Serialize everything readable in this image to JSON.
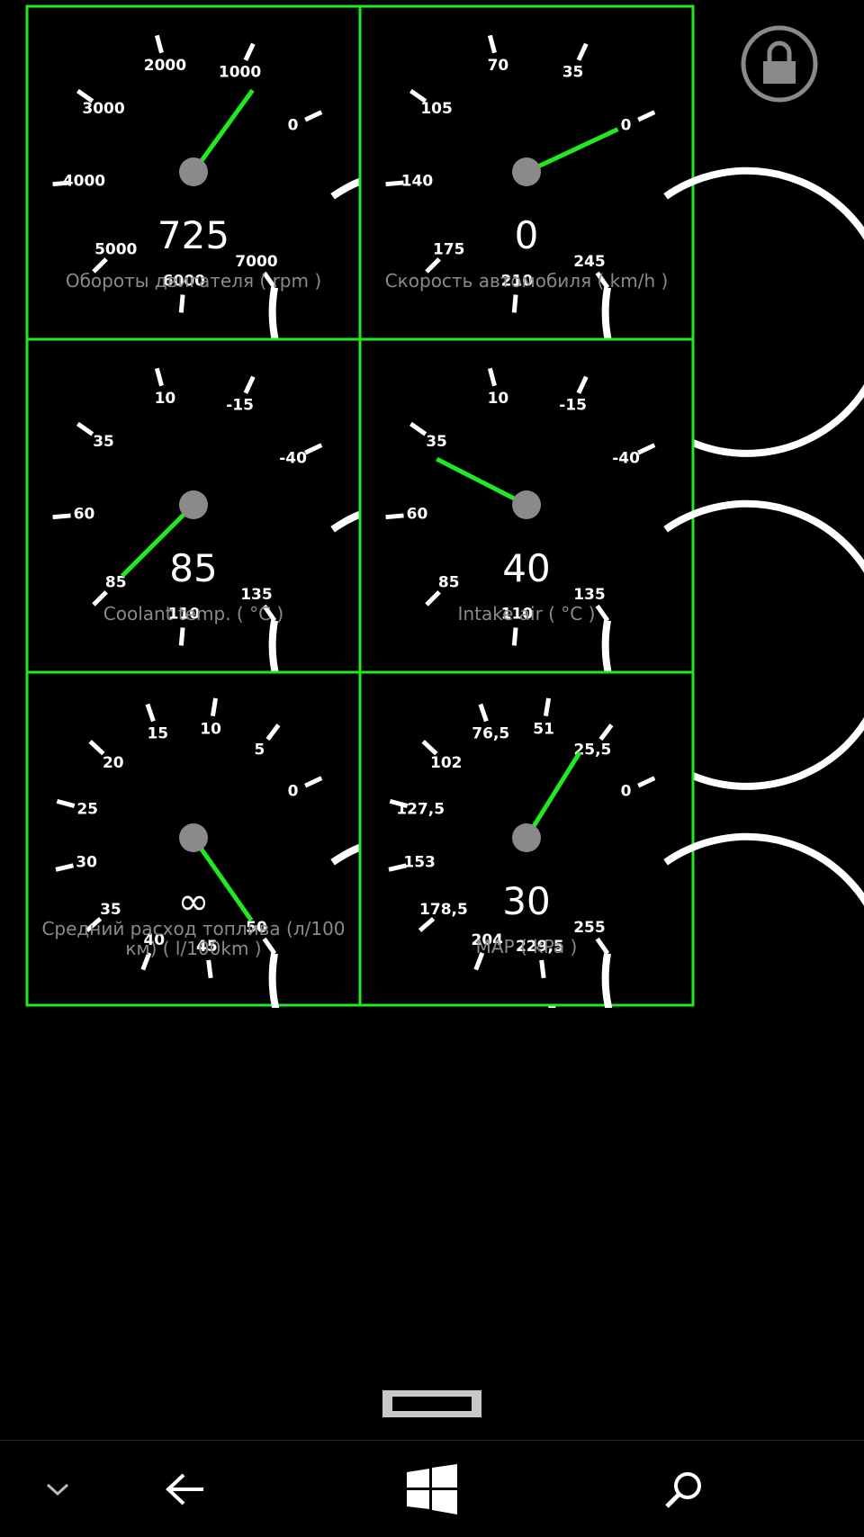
{
  "colors": {
    "accent": "#22e822",
    "needle": "#22e822",
    "hub": "#8a8a8a",
    "caption": "#8a8a8a",
    "dial": "#ffffff"
  },
  "gauges": [
    {
      "id": "rpm",
      "value": "725",
      "caption": "Обороты двигателя  ( rpm )",
      "captionLines": [
        "Обороты двигателя  ( rpm )"
      ],
      "ticks": [
        "0",
        "1000",
        "2000",
        "3000",
        "4000",
        "5000",
        "6000",
        "7000"
      ],
      "needle": 0.104
    },
    {
      "id": "speed",
      "value": "0",
      "caption": "Скорость автомобиля  ( km/h )",
      "captionLines": [
        "Скорость автомобиля  ( km/h )"
      ],
      "ticks": [
        "0",
        "35",
        "70",
        "105",
        "140",
        "175",
        "210",
        "245"
      ],
      "needle": 0.0
    },
    {
      "id": "coolant",
      "value": "85",
      "caption": "Coolant temp.  ( °C )",
      "captionLines": [
        "Coolant temp.  ( °C )"
      ],
      "ticks": [
        "-40",
        "-15",
        "10",
        "35",
        "60",
        "85",
        "110",
        "135"
      ],
      "needle": 0.714
    },
    {
      "id": "intake",
      "value": "40",
      "caption": "Intake air  ( °C )",
      "captionLines": [
        "Intake air  ( °C )"
      ],
      "ticks": [
        "-40",
        "-15",
        "10",
        "35",
        "60",
        "85",
        "110",
        "135"
      ],
      "needle": 0.457
    },
    {
      "id": "fuel",
      "value": "∞",
      "caption": "Средний расход топлива (л/100 км)  ( l/100km )",
      "captionLines": [
        "Средний расход топлива (л/100",
        "км)  ( l/100km )"
      ],
      "ticks": [
        "0",
        "5",
        "10",
        "15",
        "20",
        "25",
        "30",
        "35",
        "40",
        "45",
        "50"
      ],
      "needle": 1.0
    },
    {
      "id": "map",
      "value": "30",
      "caption": "MAP  ( kPa )",
      "captionLines": [
        "MAP  ( kPa )"
      ],
      "ticks": [
        "0",
        "25,5",
        "51",
        "76,5",
        "102",
        "127,5",
        "153",
        "178,5",
        "204",
        "229,5",
        "255"
      ],
      "needle": 0.118
    }
  ],
  "nav": {
    "chevron": "chevron-down-icon",
    "back": "back-arrow-icon",
    "home": "windows-icon",
    "search": "search-icon"
  },
  "lock_icon": "lock-icon"
}
